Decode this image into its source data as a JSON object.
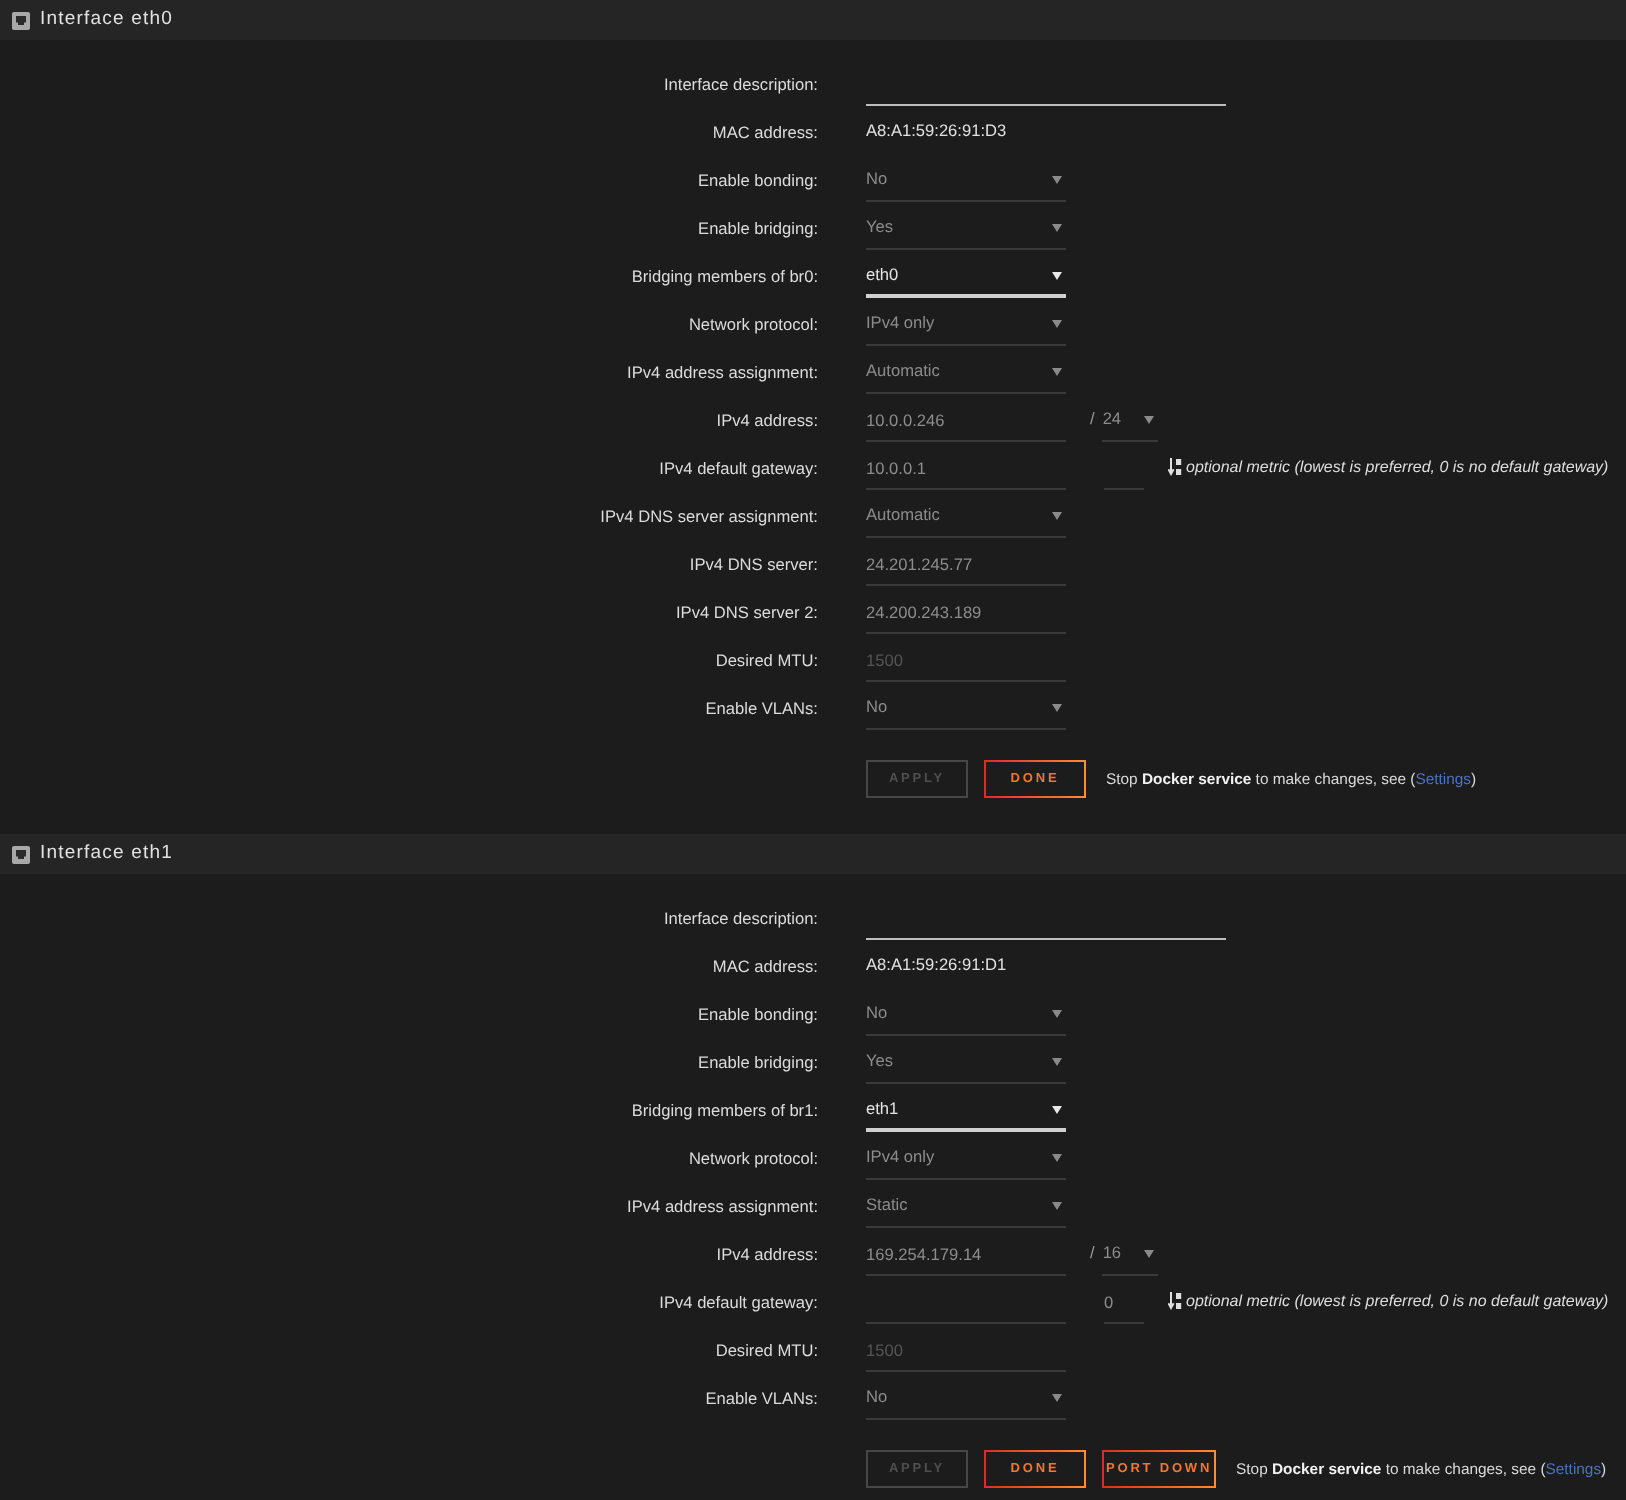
{
  "sections": [
    {
      "title": "Interface eth0",
      "fields": [
        {
          "kind": "longtext",
          "label": "Interface description:",
          "disabled": false
        },
        {
          "kind": "static",
          "label": "MAC address:",
          "value": "A8:A1:59:26:91:D3"
        },
        {
          "kind": "select",
          "label": "Enable bonding:",
          "value": "No",
          "disabled": true
        },
        {
          "kind": "select",
          "label": "Enable bridging:",
          "value": "Yes",
          "disabled": true
        },
        {
          "kind": "select",
          "label": "Bridging members of br0:",
          "value": "eth0",
          "disabled": false
        },
        {
          "kind": "select",
          "label": "Network protocol:",
          "value": "IPv4 only",
          "disabled": true
        },
        {
          "kind": "select",
          "label": "IPv4 address assignment:",
          "value": "Automatic",
          "disabled": true
        },
        {
          "kind": "address",
          "label": "IPv4 address:",
          "value": "10.0.0.246",
          "separator": "/",
          "netmask": "24",
          "disabled": true
        },
        {
          "kind": "gateway",
          "label": "IPv4 default gateway:",
          "value": "10.0.0.1",
          "hint": "optional metric (lowest is preferred, 0 is no default gateway)",
          "disabled": true
        },
        {
          "kind": "select",
          "label": "IPv4 DNS server assignment:",
          "value": "Automatic",
          "disabled": true
        },
        {
          "kind": "text",
          "label": "IPv4 DNS server:",
          "value": "24.201.245.77",
          "disabled": true
        },
        {
          "kind": "text",
          "label": "IPv4 DNS server 2:",
          "value": "24.200.243.189",
          "disabled": true
        },
        {
          "kind": "text",
          "label": "Desired MTU:",
          "placeholder": "1500",
          "disabled": true
        },
        {
          "kind": "select",
          "label": "Enable VLANs:",
          "value": "No",
          "disabled": true
        }
      ],
      "buttons": [
        {
          "label": "APPLY",
          "disabled": true
        },
        {
          "label": "DONE",
          "disabled": false
        }
      ],
      "note": {
        "before": "Stop **Docker service** to make changes, see (",
        "link": "Settings",
        "after": ")"
      }
    },
    {
      "title": "Interface eth1",
      "fields": [
        {
          "kind": "longtext",
          "label": "Interface description:",
          "disabled": false
        },
        {
          "kind": "static",
          "label": "MAC address:",
          "value": "A8:A1:59:26:91:D1"
        },
        {
          "kind": "select",
          "label": "Enable bonding:",
          "value": "No",
          "disabled": true
        },
        {
          "kind": "select",
          "label": "Enable bridging:",
          "value": "Yes",
          "disabled": true
        },
        {
          "kind": "select",
          "label": "Bridging members of br1:",
          "value": "eth1",
          "disabled": false
        },
        {
          "kind": "select",
          "label": "Network protocol:",
          "value": "IPv4 only",
          "disabled": true
        },
        {
          "kind": "select",
          "label": "IPv4 address assignment:",
          "value": "Static",
          "disabled": true
        },
        {
          "kind": "address",
          "label": "IPv4 address:",
          "value": "169.254.179.14",
          "separator": "/",
          "netmask": "16",
          "disabled": true
        },
        {
          "kind": "gateway",
          "label": "IPv4 default gateway:",
          "metric": "0",
          "hint": "optional metric (lowest is preferred, 0 is no default gateway)",
          "disabled": true
        },
        {
          "kind": "text",
          "label": "Desired MTU:",
          "placeholder": "1500",
          "disabled": true
        },
        {
          "kind": "select",
          "label": "Enable VLANs:",
          "value": "No",
          "disabled": true
        }
      ],
      "buttons": [
        {
          "label": "APPLY",
          "disabled": true
        },
        {
          "label": "DONE",
          "disabled": false
        },
        {
          "label": "PORT DOWN",
          "disabled": false
        }
      ],
      "note": {
        "before": "Stop **Docker service** to make changes, see (",
        "link": "Settings",
        "after": ")"
      }
    }
  ]
}
